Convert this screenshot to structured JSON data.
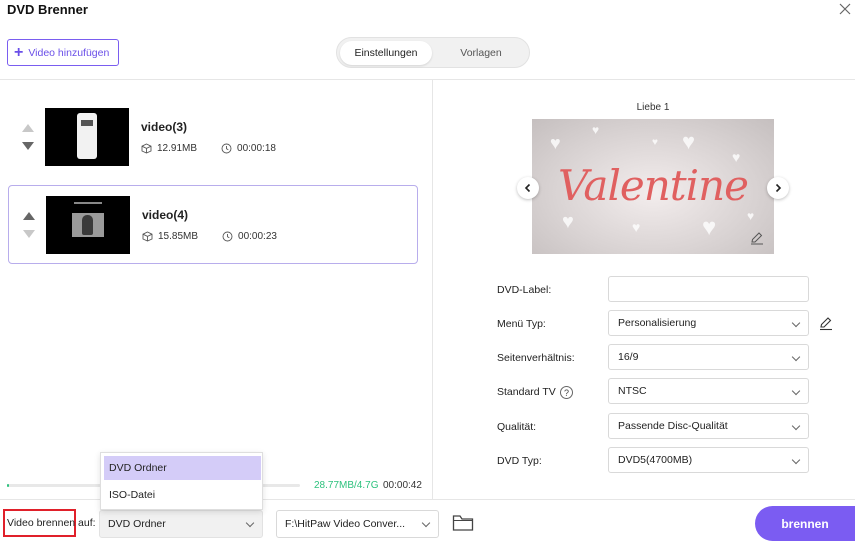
{
  "window": {
    "title": "DVD Brenner"
  },
  "toolbar": {
    "add_video_label": "Video hinzufügen"
  },
  "tabs": [
    {
      "label": "Einstellungen",
      "active": true
    },
    {
      "label": "Vorlagen",
      "active": false
    }
  ],
  "videos": [
    {
      "name": "video(3)",
      "size": "12.91MB",
      "duration": "00:00:18",
      "selected": false
    },
    {
      "name": "video(4)",
      "size": "15.85MB",
      "duration": "00:00:23",
      "selected": true
    }
  ],
  "progress": {
    "used": "28.77MB/4.7G",
    "duration": "00:00:42",
    "fraction": 0.006,
    "color": "#2ec27e"
  },
  "preview": {
    "title": "Liebe 1",
    "text": "Valentine"
  },
  "settings": [
    {
      "label": "DVD-Label:",
      "value": ""
    },
    {
      "label": "Menü Typ:",
      "value": "Personalisierung"
    },
    {
      "label": "Seitenverhältnis:",
      "value": "16/9"
    },
    {
      "label": "Standard TV",
      "value": "NTSC"
    },
    {
      "label": "Qualität:",
      "value": "Passende Disc-Qualität"
    },
    {
      "label": "DVD Typ:",
      "value": "DVD5(4700MB)"
    }
  ],
  "bottom": {
    "burn_to_label": "Video brennen auf:",
    "target_value": "DVD Ordner",
    "path_value": "F:\\HitPaw Video Conver...",
    "burn_button": "brennen"
  },
  "dropdown_menu": {
    "options": [
      "DVD Ordner",
      "ISO-Datei"
    ],
    "highlighted": "DVD Ordner"
  },
  "colors": {
    "accent": "#7b5cf2",
    "highlight": "#e0202a"
  }
}
